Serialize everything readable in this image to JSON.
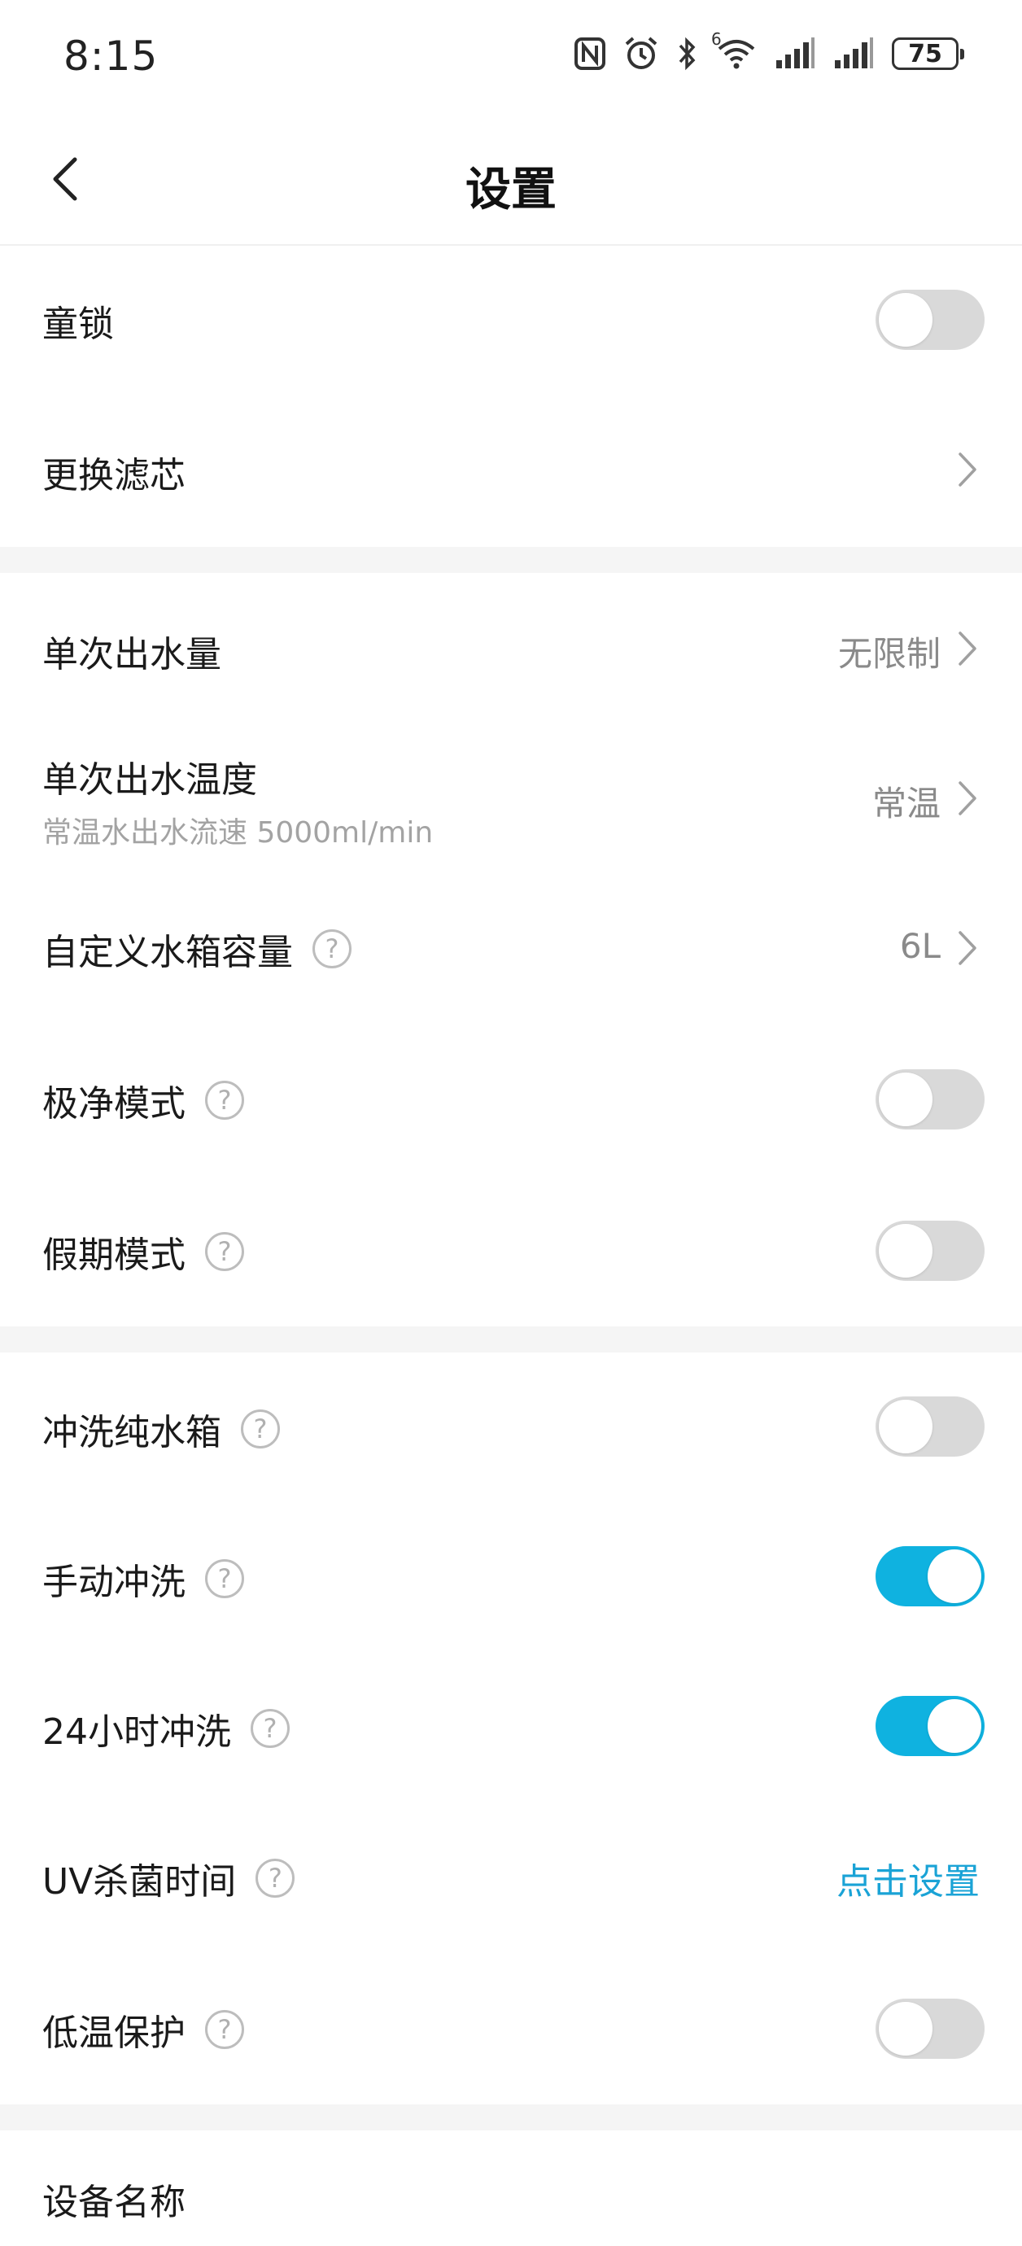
{
  "status_bar": {
    "time": "8:15",
    "battery": "75",
    "icons": [
      "nfc-icon",
      "alarm-icon",
      "bluetooth-icon",
      "wifi-icon",
      "signal-icon",
      "signal-icon",
      "battery-icon"
    ],
    "wifi_badge": "6"
  },
  "header": {
    "title": "设置",
    "back_icon": "chevron-left-icon"
  },
  "rows": {
    "child_lock": {
      "label": "童锁",
      "toggle_on": false
    },
    "replace_filter": {
      "label": "更换滤芯"
    },
    "single_volume": {
      "label": "单次出水量",
      "value": "无限制"
    },
    "single_temp": {
      "label": "单次出水温度",
      "sub": "常温水出水流速 5000ml/min",
      "value": "常温"
    },
    "tank_capacity": {
      "label": "自定义水箱容量",
      "value": "6L"
    },
    "ultra_clean": {
      "label": "极净模式",
      "toggle_on": false
    },
    "holiday": {
      "label": "假期模式",
      "toggle_on": false
    },
    "flush_tank": {
      "label": "冲洗纯水箱",
      "toggle_on": false
    },
    "manual_flush": {
      "label": "手动冲洗",
      "toggle_on": true
    },
    "flush_24h": {
      "label": "24小时冲洗",
      "toggle_on": true
    },
    "uv_time": {
      "label": "UV杀菌时间",
      "link": "点击设置"
    },
    "low_temp": {
      "label": "低温保护",
      "toggle_on": false
    },
    "device_name": {
      "label": "设备名称"
    }
  },
  "help_glyph": "?",
  "colors": {
    "accent": "#0fb2e0",
    "link": "#1aa3d6",
    "toggle_off": "#d9d9d9",
    "section_gap": "#f5f5f5"
  }
}
